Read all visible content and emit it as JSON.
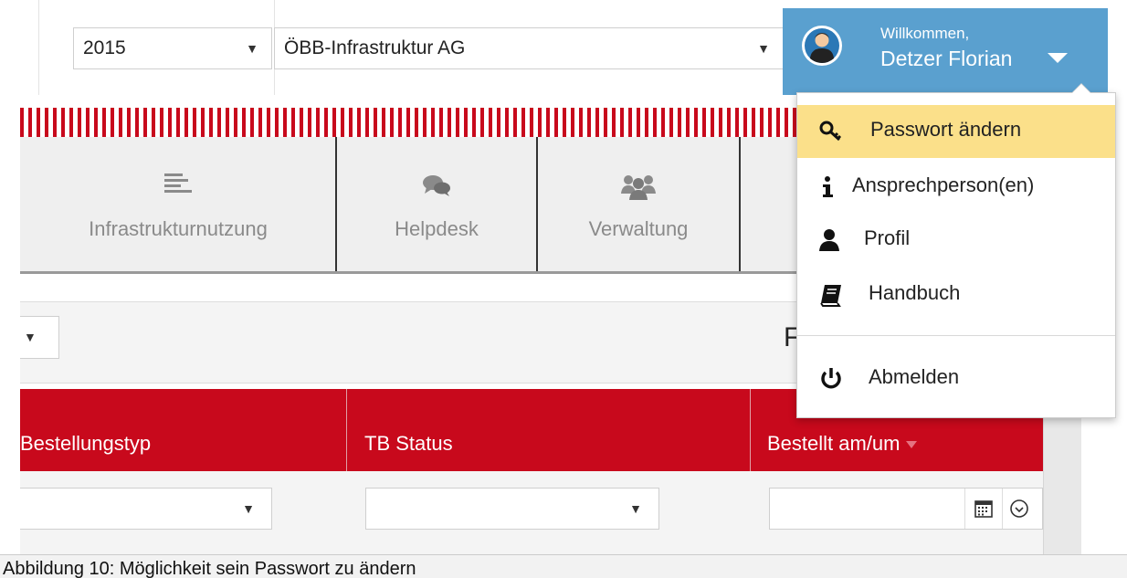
{
  "header": {
    "year_select": {
      "value": "2015"
    },
    "company_select": {
      "value": "ÖBB-Infrastruktur AG"
    },
    "user": {
      "greeting": "Willkommen,",
      "name": "Detzer Florian"
    }
  },
  "nav": {
    "items": [
      {
        "label": "Infrastrukturnutzung",
        "icon": "list-icon"
      },
      {
        "label": "Helpdesk",
        "icon": "chat-bubbles-icon"
      },
      {
        "label": "Verwaltung",
        "icon": "users-icon"
      }
    ]
  },
  "user_menu": {
    "items": [
      {
        "label": "Passwort ändern",
        "icon": "key-icon",
        "highlighted": true
      },
      {
        "label": "Ansprechperson(en)",
        "icon": "info-icon"
      },
      {
        "label": "Profil",
        "icon": "user-icon"
      },
      {
        "label": "Handbuch",
        "icon": "book-icon"
      },
      {
        "label": "Abmelden",
        "icon": "power-icon"
      }
    ]
  },
  "filter": {
    "partial_label": "F"
  },
  "table": {
    "columns": [
      {
        "label": "Bestellungstyp"
      },
      {
        "label": "TB Status"
      },
      {
        "label": "Bestellt am/um",
        "sorted": "desc"
      }
    ]
  },
  "caption": "Abbildung 10: Möglichkeit sein Passwort zu ändern",
  "colors": {
    "brand_red": "#c8091c",
    "user_blue": "#5aa0cf",
    "highlight": "#fbe08a"
  }
}
